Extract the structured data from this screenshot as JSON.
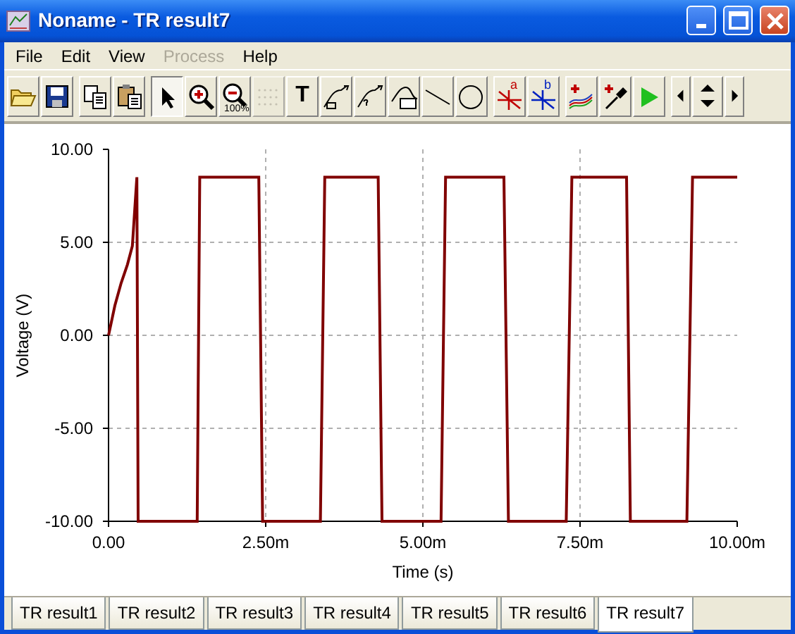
{
  "window": {
    "title": "Noname - TR result7"
  },
  "menu": [
    {
      "label": "File",
      "disabled": false
    },
    {
      "label": "Edit",
      "disabled": false
    },
    {
      "label": "View",
      "disabled": false
    },
    {
      "label": "Process",
      "disabled": true
    },
    {
      "label": "Help",
      "disabled": false
    }
  ],
  "toolbar": [
    [
      {
        "kind": "open"
      },
      {
        "kind": "save"
      }
    ],
    [
      {
        "kind": "copy"
      },
      {
        "kind": "paste"
      }
    ],
    [
      {
        "kind": "pointer",
        "selected": true
      },
      {
        "kind": "zoomin",
        "selected": false
      },
      {
        "kind": "zoomout",
        "selected": false,
        "text": "100%"
      },
      {
        "kind": "grid",
        "disabled": true
      },
      {
        "kind": "text",
        "text": "T"
      },
      {
        "kind": "annot1"
      },
      {
        "kind": "annot2"
      },
      {
        "kind": "annot3"
      },
      {
        "kind": "line"
      },
      {
        "kind": "circle"
      }
    ],
    [
      {
        "kind": "cursora",
        "text": "a"
      },
      {
        "kind": "cursorb",
        "text": "b"
      }
    ],
    [
      {
        "kind": "addcurves"
      },
      {
        "kind": "probe"
      },
      {
        "kind": "run"
      }
    ],
    [
      {
        "kind": "nav"
      }
    ]
  ],
  "chart": {
    "chart_data": {
      "type": "line",
      "grid": true,
      "xlabel": "Time (s)",
      "ylabel": "Voltage (V)",
      "xlim": [
        0,
        10
      ],
      "ylim": [
        -10,
        10
      ],
      "xticks": [
        {
          "value": 0,
          "label": "0.00"
        },
        {
          "value": 2.5,
          "label": "2.50m"
        },
        {
          "value": 5,
          "label": "5.00m"
        },
        {
          "value": 7.5,
          "label": "7.50m"
        },
        {
          "value": 10,
          "label": "10.00m"
        }
      ],
      "yticks": [
        {
          "value": -10,
          "label": "-10.00"
        },
        {
          "value": -5,
          "label": "-5.00"
        },
        {
          "value": 0,
          "label": "0.00"
        },
        {
          "value": 5,
          "label": "5.00"
        },
        {
          "value": 10,
          "label": "10.00"
        }
      ],
      "x": [
        0,
        0.1,
        0.2,
        0.3,
        0.38,
        0.45,
        0.47,
        1.41,
        1.45,
        2.39,
        2.45,
        3.37,
        3.44,
        4.29,
        4.35,
        5.29,
        5.36,
        6.29,
        6.36,
        7.28,
        7.37,
        8.24,
        8.3,
        9.2,
        9.29,
        10
      ],
      "series": [
        {
          "color": "#800000",
          "values": [
            0,
            1.6,
            2.8,
            3.8,
            4.8,
            8.5,
            -10,
            -10,
            8.5,
            8.5,
            -10,
            -10,
            8.5,
            8.5,
            -10,
            -10,
            8.5,
            8.5,
            -10,
            -10,
            8.5,
            8.5,
            -10,
            -10,
            8.5,
            8.5
          ]
        }
      ]
    }
  },
  "tabs": [
    {
      "label": "TR result1",
      "selected": false
    },
    {
      "label": "TR result2",
      "selected": false
    },
    {
      "label": "TR result3",
      "selected": false
    },
    {
      "label": "TR result4",
      "selected": false
    },
    {
      "label": "TR result5",
      "selected": false
    },
    {
      "label": "TR result6",
      "selected": false
    },
    {
      "label": "TR result7",
      "selected": true
    }
  ]
}
